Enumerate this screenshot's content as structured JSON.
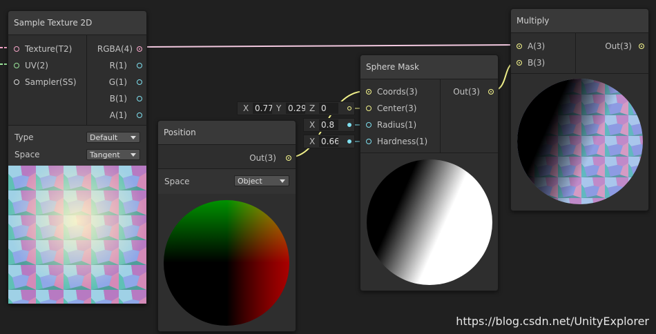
{
  "nodes": {
    "sample_texture": {
      "title": "Sample Texture 2D",
      "inputs": [
        "Texture(T2)",
        "UV(2)",
        "Sampler(SS)"
      ],
      "outputs": [
        "RGBA(4)",
        "R(1)",
        "G(1)",
        "B(1)",
        "A(1)"
      ],
      "props": {
        "type_label": "Type",
        "type_value": "Default",
        "space_label": "Space",
        "space_value": "Tangent"
      }
    },
    "position": {
      "title": "Position",
      "output": "Out(3)",
      "props": {
        "space_label": "Space",
        "space_value": "Object"
      }
    },
    "sphere_mask": {
      "title": "Sphere Mask",
      "inputs": [
        "Coords(3)",
        "Center(3)",
        "Radius(1)",
        "Hardness(1)"
      ],
      "output": "Out(3)",
      "center_field": {
        "x_label": "X",
        "x": "0.77",
        "y_label": "Y",
        "y": "0.29",
        "z_label": "Z",
        "z": "0"
      },
      "radius_field": {
        "label": "X",
        "value": "0.8"
      },
      "hardness_field": {
        "label": "X",
        "value": "0.66"
      }
    },
    "multiply": {
      "title": "Multiply",
      "inputs": [
        "A(3)",
        "B(3)"
      ],
      "output": "Out(3)"
    }
  },
  "colors": {
    "wire_color_rgba": "#f3c9e0",
    "wire_color_vec3": "#f0f08a",
    "port_vec1": "#7fe0f0"
  },
  "watermark": "https://blog.csdn.net/UnityExplorer"
}
